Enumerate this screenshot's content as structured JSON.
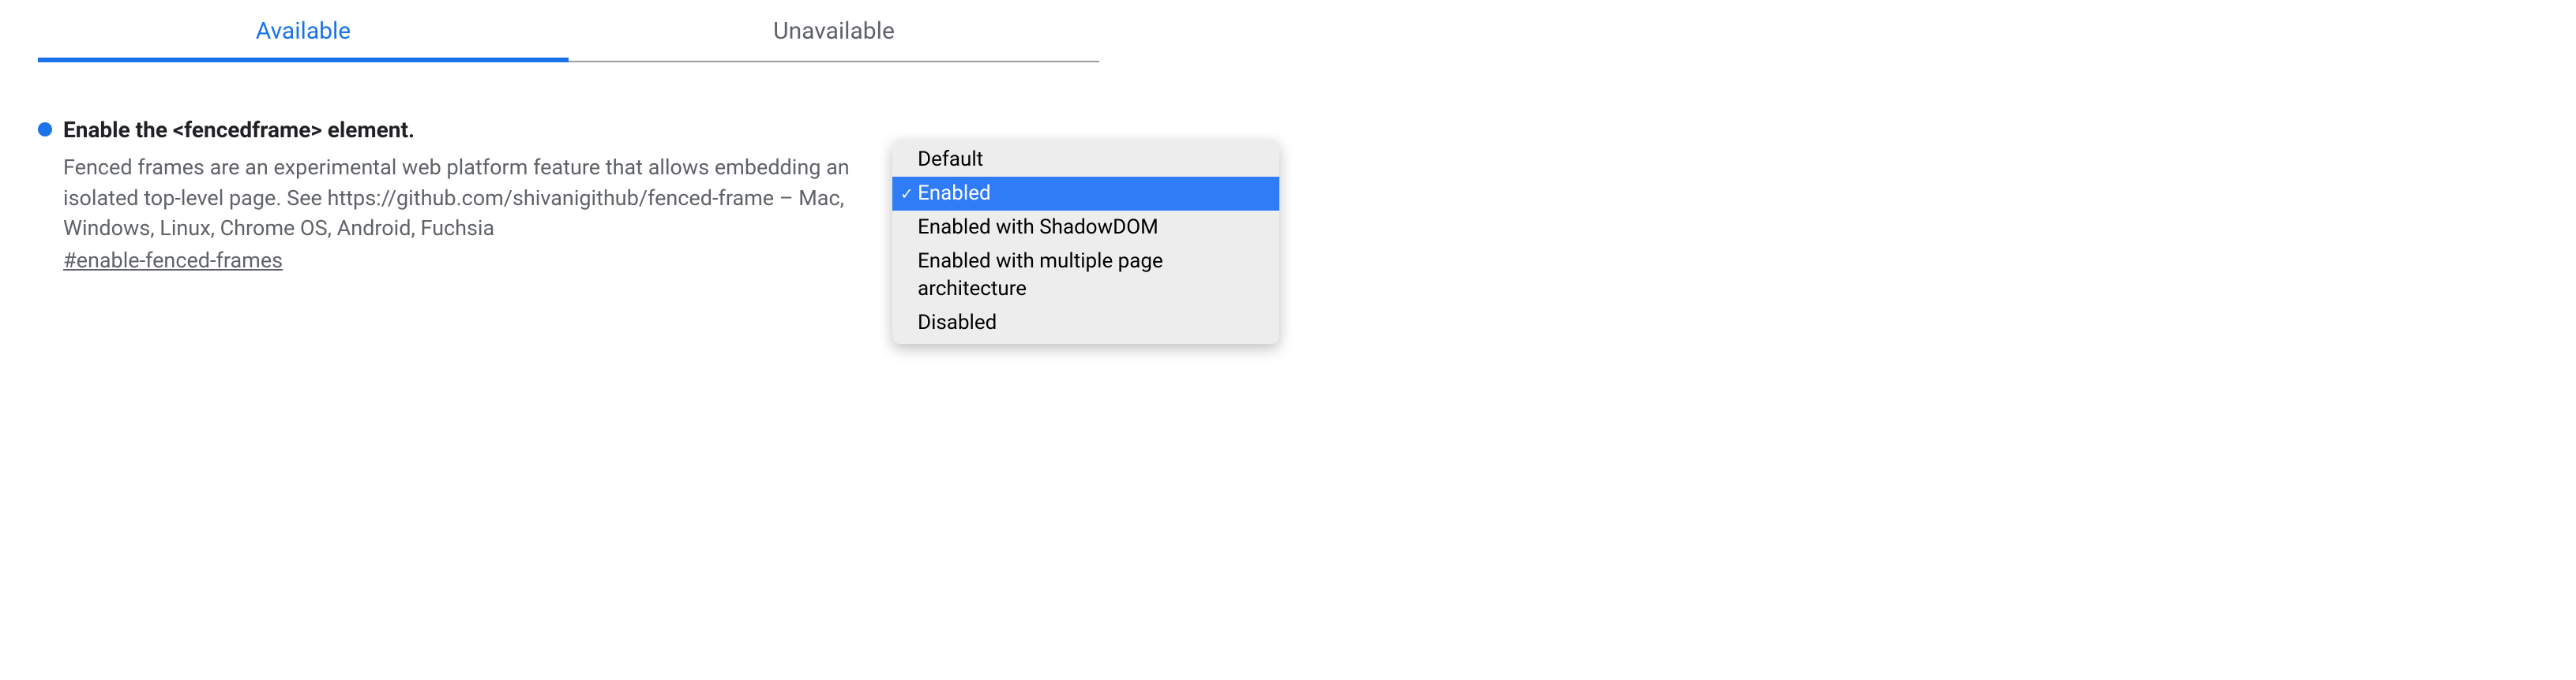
{
  "tabs": {
    "available": "Available",
    "unavailable": "Unavailable"
  },
  "flag": {
    "title": "Enable the <fencedframe> element.",
    "description": "Fenced frames are an experimental web platform feature that allows embedding an isolated top-level page. See https://github.com/shivanigithub/fenced-frame – Mac, Windows, Linux, Chrome OS, Android, Fuchsia",
    "anchor": "#enable-fenced-frames"
  },
  "dropdown": {
    "options": [
      "Default",
      "Enabled",
      "Enabled with ShadowDOM",
      "Enabled with multiple page architecture",
      "Disabled"
    ],
    "selected_index": 1
  }
}
